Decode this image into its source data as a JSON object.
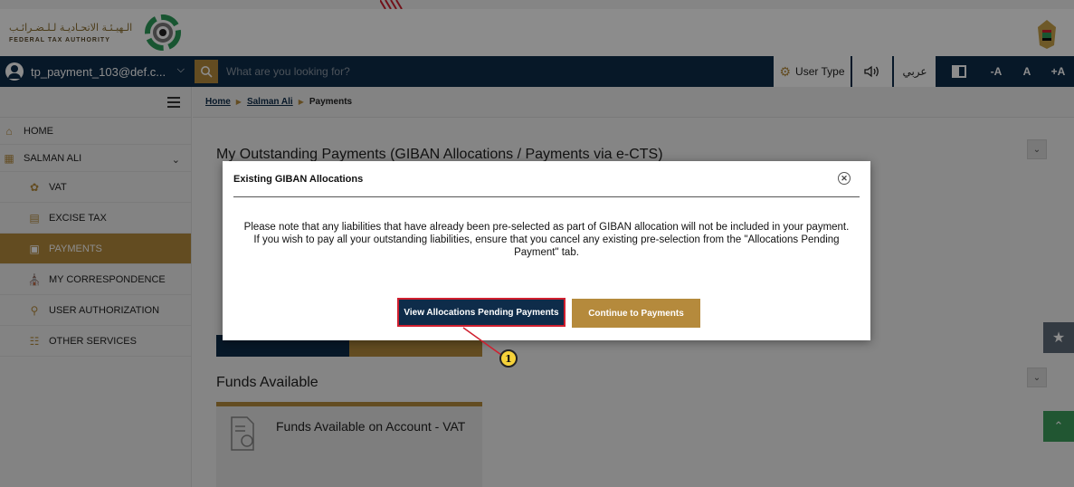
{
  "header": {
    "logo_arabic": "الـهيـئـة الاتحـاديـة لـلـضـرائـب",
    "logo_english": "FEDERAL TAX AUTHORITY"
  },
  "topbar": {
    "account": "tp_payment_103@def.c...",
    "search_placeholder": "What are you looking for?",
    "user_type": "User Type",
    "language": "عربي",
    "font_decrease": "-A",
    "font_normal": "A",
    "font_increase": "+A"
  },
  "sidebar": {
    "items": [
      {
        "label": "HOME"
      },
      {
        "label": "SALMAN ALI"
      },
      {
        "label": "VAT"
      },
      {
        "label": "EXCISE TAX"
      },
      {
        "label": "PAYMENTS"
      },
      {
        "label": "MY CORRESPONDENCE"
      },
      {
        "label": "USER AUTHORIZATION"
      },
      {
        "label": "OTHER SERVICES"
      }
    ]
  },
  "breadcrumb": {
    "home": "Home",
    "user": "Salman Ali",
    "current": "Payments"
  },
  "main": {
    "outstanding_title": "My Outstanding Payments (GIBAN Allocations / Payments via e-CTS)",
    "funds_title": "Funds Available",
    "funds_card": "Funds Available on Account - VAT"
  },
  "modal": {
    "title": "Existing GIBAN Allocations",
    "body": "Please note that any liabilities that have already been pre-selected as part of GIBAN allocation will not be included in your payment. If you wish to pay all your outstanding liabilities, ensure that you cancel any existing pre-selection from the \"Allocations Pending Payment\" tab.",
    "view_button": "View Allocations Pending Payments",
    "continue_button": "Continue to Payments"
  },
  "annotation": {
    "step": "1"
  },
  "colors": {
    "navy": "#0e2c4a",
    "gold": "#b58a3c",
    "highlight": "#d01f2f"
  }
}
